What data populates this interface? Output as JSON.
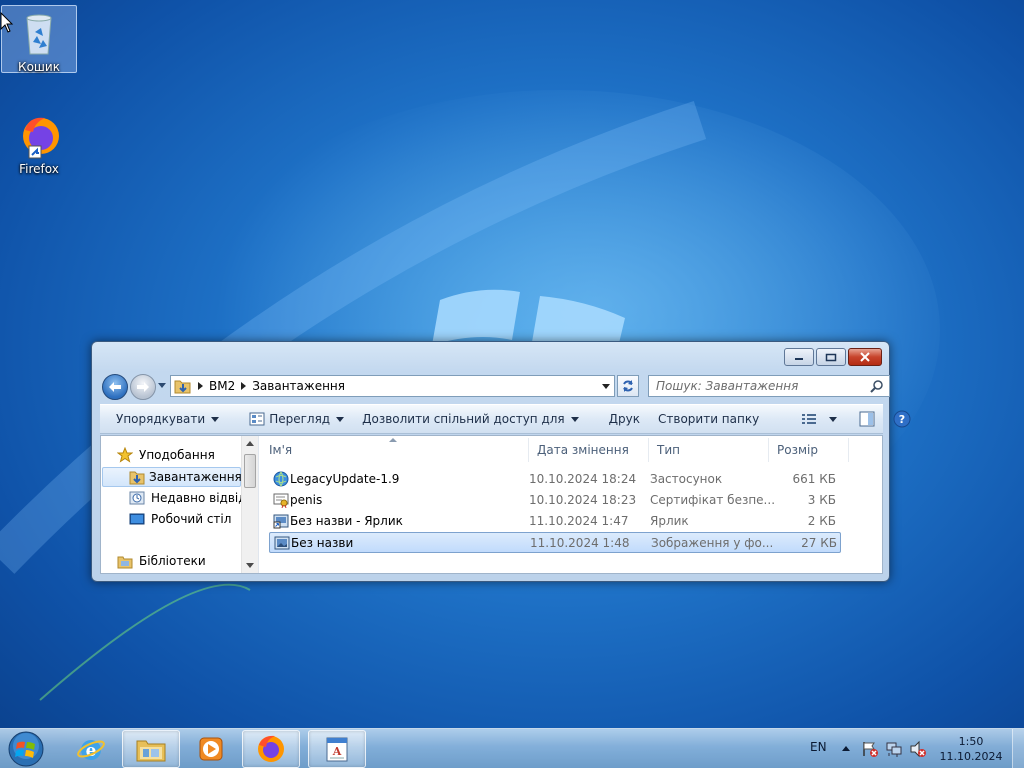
{
  "desktop": {
    "icons": [
      {
        "label": "Кошик",
        "icon": "recycle-bin-icon"
      },
      {
        "label": "Firefox",
        "icon": "firefox-icon"
      }
    ]
  },
  "explorer": {
    "breadcrumb": [
      "BM2",
      "Завантаження"
    ],
    "search_placeholder": "Пошук: Завантаження",
    "toolbar": {
      "organize": "Упорядкувати",
      "view": "Перегляд",
      "share": "Дозволити спільний доступ для",
      "print": "Друк",
      "new_folder": "Створити папку"
    },
    "nav": [
      {
        "label": "Уподобання",
        "icon": "star-icon",
        "selected": false
      },
      {
        "label": "Завантаження",
        "icon": "downloads-folder-icon",
        "selected": true
      },
      {
        "label": "Недавно відвідані місця",
        "icon": "recent-places-icon",
        "selected": false
      },
      {
        "label": "Робочий стіл",
        "icon": "desktop-icon",
        "selected": false
      },
      {
        "label": "Бібліотеки",
        "icon": "libraries-icon",
        "selected": false
      }
    ],
    "columns": {
      "name": "Ім'я",
      "date": "Дата змінення",
      "type": "Тип",
      "size": "Розмір"
    },
    "files": [
      {
        "name": "LegacyUpdate-1.9",
        "date": "10.10.2024 18:24",
        "type": "Застосунок",
        "size": "661 КБ",
        "icon": "app-globe-icon",
        "selected": false
      },
      {
        "name": "penis",
        "date": "10.10.2024 18:23",
        "type": "Сертифікат безпе...",
        "size": "3 КБ",
        "icon": "certificate-icon",
        "selected": false
      },
      {
        "name": "Без назви - Ярлик",
        "date": "11.10.2024 1:47",
        "type": "Ярлик",
        "size": "2 КБ",
        "icon": "shortcut-icon",
        "selected": false
      },
      {
        "name": "Без назви",
        "date": "11.10.2024 1:48",
        "type": "Зображення у фо...",
        "size": "27 КБ",
        "icon": "image-file-icon",
        "selected": true
      }
    ]
  },
  "taskbar": {
    "pinned": [
      "internet-explorer-icon",
      "explorer-folder-icon",
      "media-player-icon",
      "firefox-icon",
      "wordpad-icon"
    ],
    "language": "EN",
    "time": "1:50",
    "date": "11.10.2024"
  }
}
